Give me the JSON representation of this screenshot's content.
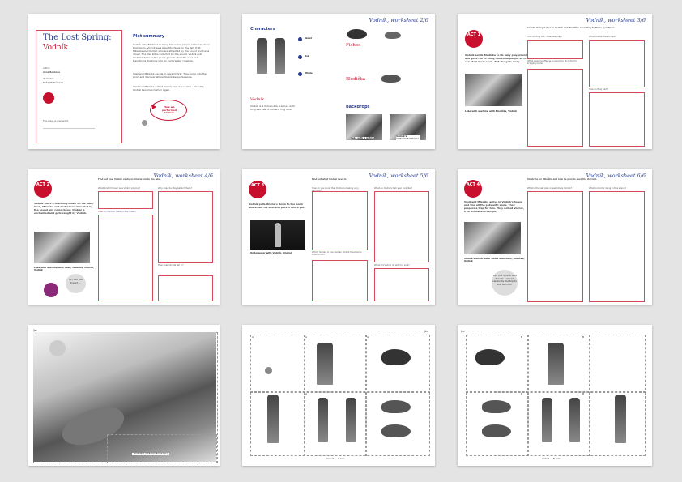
{
  "p1": {
    "title": "The Lost Spring:",
    "subtitle": "Vodník",
    "author_label": "Author",
    "author": "Anna Bobková",
    "illustration_label": "Illustration",
    "illustrator": "Soňa Abrhámová",
    "plot_heading": "Plot summary",
    "plot_p1": "Vodník asks Blodička to bring him some people as he can drain their souls. Vodník sees beautiful faces on the fish, fruit, Mikeška and Ondral, who are attracted by the sound and turns closer. The Owl kid is collected by the sound. Vodník puts Ondral's down in the pond, goes to steal the soul and transforms the body into an underwater creature.",
    "plot_p2": "Vasil and Mikeška decide to save Ondral. They jump into the pond and discover where Vodník keeps his souls.",
    "plot_p3": "Vasil and Mikeška defeat Vodník and rescue him - Ondral's Ondral becomes human again.",
    "callout": "How we performed Vodník",
    "stage_label": "This stage is licensed to:"
  },
  "p2": {
    "header": "Vodník, worksheet 2/6",
    "characters": "Characters",
    "vodnik": "Vodník",
    "fishes": "Fishes",
    "blodicka": "Blodička",
    "backdrops": "Backdrops",
    "rows": [
      "Skeet",
      "Bob",
      "Whale"
    ],
    "cap1": "Lake with a willow",
    "cap2": "Vodník's underwater home"
  },
  "p3": {
    "header": "Vodník, worksheet 3/6",
    "act": "ACT 1",
    "intro": "Vodník sends Blodička to its fairy playground and goes fun to bring him some people so he can steal their souls. But she gets away.",
    "photo_cap": "Lake with a willow with Blodička, Vodník",
    "top_title": "Create dialog between Vodník and Blodička according to these questions:",
    "q1": "How do they act? What are they?",
    "q2": "What is Blodička worried?",
    "q3": "What steps he offer as a reward to Blodička for bringing souls?",
    "q4": "How do they part?"
  },
  "p4": {
    "header": "Vodník, worksheet 4/6",
    "act": "ACT 2",
    "intro": "Vodník plays a charming music on his flute; Vasil, Mikeška and Ondral are attracted by the sound and come closer. Ondral is enchanted and gets caught by Vodník.",
    "photo_cap": "Lake with a willow with Vasil, Mikeška, Ondral, Vodník",
    "top_title": "Find out how Vodník captures Ondral inside the lake.",
    "q1": "What kind of music was Vodník playing?",
    "q2": "How do children react to this music?",
    "q3": "Why does he stay behind them?",
    "q4": "How does Ondral fall in?",
    "tip": "TIP! Did you know? ..."
  },
  "p5": {
    "header": "Vodník, worksheet 5/6",
    "act": "ACT 3",
    "intro": "Vodník pulls Ondral's down to the pond and steals his soul and puts it into a pot.",
    "photo_cap": "Underwater with Vodník, Ondral",
    "top_title": "Find out what Ondral lives in.",
    "q1": "How do you know that Ondral is feeling very nervous?",
    "q2": "What do Ondral's fish soul look like?",
    "q3": "Which human or non-human Vodník transforms Ondral into?",
    "q4": "What did Vodník do with his soul?"
  },
  "p6": {
    "header": "Vodník, worksheet 6/6",
    "act": "ACT 4",
    "intro": "Vasil and Mikeška arrive in Vodník's house and find all the pots with souls. They prepare a trap for him. They defeat Vodník, free Ondral and escape.",
    "photo_cap": "Vodník's underwater home with Vasil, Mikeška, Vodník",
    "top_title": "Illustrate on Mikeška and how he plan to save the Owl kid.",
    "q1": "What is the last plan or swimmers Vodník?",
    "q2": "What is Ondral doing in this scene?",
    "tip": "TIP! Cut Vodník and friends out and celebrate the trip to the Owl kid!"
  },
  "p7": {
    "caption": "Vodník's underwater home"
  },
  "p8": {
    "caption": "Vodník — A side",
    "markers": [
      "A",
      "A",
      "A",
      "A"
    ]
  },
  "p9": {
    "caption": "Vodník — B side",
    "markers": [
      "B",
      "B",
      "B",
      "B"
    ]
  }
}
